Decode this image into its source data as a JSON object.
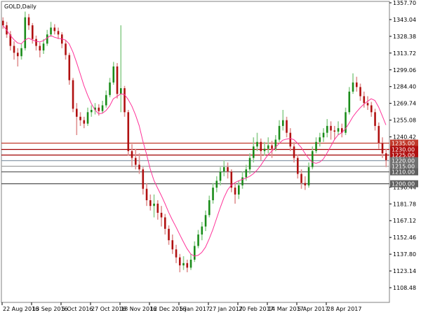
{
  "chart_data": {
    "type": "candlestick",
    "title": "GOLD,Daily",
    "ylim": [
      1108.48,
      1357.7
    ],
    "y_ticks": [
      "1357.70",
      "1343.04",
      "1328.38",
      "1313.72",
      "1299.06",
      "1284.40",
      "1269.74",
      "1255.08",
      "1240.42",
      "1196.44",
      "1181.78",
      "1167.12",
      "1152.46",
      "1137.80",
      "1123.14",
      "1108.48"
    ],
    "x_ticks": [
      "22 Aug 2016",
      "13 Sep 2016",
      "5 Oct 2016",
      "27 Oct 2016",
      "18 Nov 2016",
      "12 Dec 2016",
      "5 Jan 2017",
      "27 Jan 2017",
      "20 Feb 2017",
      "14 Mar 2017",
      "5 Apr 2017",
      "28 Apr 2017"
    ],
    "ohlc": [
      [
        1342,
        1345,
        1335,
        1338
      ],
      [
        1338,
        1341,
        1327,
        1330
      ],
      [
        1330,
        1333,
        1316,
        1320
      ],
      [
        1320,
        1324,
        1308,
        1314
      ],
      [
        1314,
        1318,
        1302,
        1311
      ],
      [
        1311,
        1322,
        1308,
        1318
      ],
      [
        1318,
        1350,
        1316,
        1345
      ],
      [
        1345,
        1348,
        1334,
        1338
      ],
      [
        1338,
        1340,
        1322,
        1326
      ],
      [
        1326,
        1329,
        1316,
        1320
      ],
      [
        1320,
        1323,
        1310,
        1316
      ],
      [
        1316,
        1326,
        1313,
        1322
      ],
      [
        1322,
        1334,
        1320,
        1330
      ],
      [
        1330,
        1341,
        1328,
        1336
      ],
      [
        1336,
        1339,
        1330,
        1333
      ],
      [
        1333,
        1336,
        1326,
        1330
      ],
      [
        1330,
        1332,
        1318,
        1322
      ],
      [
        1322,
        1325,
        1308,
        1312
      ],
      [
        1312,
        1314,
        1286,
        1290
      ],
      [
        1290,
        1292,
        1262,
        1265
      ],
      [
        1265,
        1270,
        1242,
        1258
      ],
      [
        1258,
        1262,
        1250,
        1255
      ],
      [
        1255,
        1258,
        1248,
        1252
      ],
      [
        1252,
        1266,
        1250,
        1262
      ],
      [
        1262,
        1268,
        1258,
        1264
      ],
      [
        1264,
        1270,
        1260,
        1266
      ],
      [
        1266,
        1269,
        1259,
        1263
      ],
      [
        1263,
        1272,
        1261,
        1268
      ],
      [
        1268,
        1281,
        1266,
        1277
      ],
      [
        1277,
        1292,
        1275,
        1288
      ],
      [
        1288,
        1306,
        1286,
        1302
      ],
      [
        1302,
        1305,
        1274,
        1278
      ],
      [
        1278,
        1338,
        1262,
        1283
      ],
      [
        1283,
        1285,
        1258,
        1262
      ],
      [
        1262,
        1264,
        1224,
        1228
      ],
      [
        1228,
        1234,
        1214,
        1222
      ],
      [
        1222,
        1230,
        1212,
        1216
      ],
      [
        1216,
        1226,
        1208,
        1212
      ],
      [
        1212,
        1214,
        1190,
        1195
      ],
      [
        1195,
        1200,
        1180,
        1185
      ],
      [
        1185,
        1190,
        1176,
        1180
      ],
      [
        1180,
        1190,
        1170,
        1182
      ],
      [
        1182,
        1185,
        1168,
        1174
      ],
      [
        1174,
        1180,
        1162,
        1170
      ],
      [
        1170,
        1173,
        1155,
        1160
      ],
      [
        1160,
        1163,
        1146,
        1150
      ],
      [
        1150,
        1155,
        1138,
        1142
      ],
      [
        1142,
        1146,
        1130,
        1135
      ],
      [
        1135,
        1138,
        1122,
        1128
      ],
      [
        1128,
        1136,
        1124,
        1130
      ],
      [
        1130,
        1133,
        1122,
        1126
      ],
      [
        1126,
        1138,
        1124,
        1133
      ],
      [
        1133,
        1149,
        1131,
        1145
      ],
      [
        1145,
        1159,
        1143,
        1155
      ],
      [
        1155,
        1166,
        1150,
        1162
      ],
      [
        1162,
        1176,
        1158,
        1172
      ],
      [
        1172,
        1189,
        1170,
        1185
      ],
      [
        1185,
        1200,
        1182,
        1196
      ],
      [
        1196,
        1206,
        1192,
        1202
      ],
      [
        1202,
        1214,
        1198,
        1210
      ],
      [
        1210,
        1220,
        1206,
        1214
      ],
      [
        1214,
        1218,
        1204,
        1210
      ],
      [
        1210,
        1212,
        1192,
        1196
      ],
      [
        1196,
        1200,
        1182,
        1190
      ],
      [
        1190,
        1202,
        1186,
        1198
      ],
      [
        1198,
        1210,
        1195,
        1205
      ],
      [
        1205,
        1216,
        1202,
        1212
      ],
      [
        1212,
        1226,
        1208,
        1222
      ],
      [
        1222,
        1240,
        1218,
        1232
      ],
      [
        1232,
        1244,
        1228,
        1236
      ],
      [
        1236,
        1239,
        1220,
        1228
      ],
      [
        1228,
        1236,
        1224,
        1230
      ],
      [
        1230,
        1240,
        1226,
        1233
      ],
      [
        1233,
        1237,
        1222,
        1230
      ],
      [
        1230,
        1242,
        1228,
        1238
      ],
      [
        1238,
        1255,
        1236,
        1250
      ],
      [
        1250,
        1264,
        1246,
        1255
      ],
      [
        1255,
        1258,
        1240,
        1244
      ],
      [
        1244,
        1248,
        1228,
        1232
      ],
      [
        1232,
        1236,
        1218,
        1222
      ],
      [
        1222,
        1225,
        1204,
        1208
      ],
      [
        1208,
        1212,
        1195,
        1200
      ],
      [
        1200,
        1206,
        1194,
        1198
      ],
      [
        1198,
        1218,
        1196,
        1214
      ],
      [
        1214,
        1232,
        1212,
        1228
      ],
      [
        1228,
        1240,
        1226,
        1236
      ],
      [
        1236,
        1244,
        1232,
        1240
      ],
      [
        1240,
        1248,
        1236,
        1244
      ],
      [
        1244,
        1256,
        1240,
        1250
      ],
      [
        1250,
        1254,
        1238,
        1246
      ],
      [
        1246,
        1250,
        1238,
        1245
      ],
      [
        1245,
        1254,
        1242,
        1248
      ],
      [
        1248,
        1252,
        1240,
        1244
      ],
      [
        1244,
        1266,
        1242,
        1262
      ],
      [
        1262,
        1284,
        1260,
        1280
      ],
      [
        1280,
        1296,
        1278,
        1288
      ],
      [
        1288,
        1293,
        1280,
        1284
      ],
      [
        1284,
        1287,
        1272,
        1276
      ],
      [
        1276,
        1280,
        1266,
        1270
      ],
      [
        1270,
        1276,
        1264,
        1268
      ],
      [
        1268,
        1271,
        1258,
        1262
      ],
      [
        1262,
        1265,
        1246,
        1250
      ],
      [
        1250,
        1253,
        1230,
        1235
      ],
      [
        1235,
        1240,
        1222,
        1226
      ],
      [
        1226,
        1230,
        1214,
        1220
      ]
    ],
    "moving_average": {
      "period": 8,
      "color": "#ff3399"
    },
    "levels": [
      {
        "price": 1235,
        "label": "1235.00",
        "color": "#c0392b",
        "box": "#c0392b"
      },
      {
        "price": 1230,
        "label": "1230.00",
        "color": "#a00000",
        "box": "#b01010"
      },
      {
        "price": 1225,
        "label": "1225.00",
        "color": "#a00000",
        "box": "#b01010"
      },
      {
        "price": 1220,
        "label": "1220.00",
        "color": "#8a9aa8",
        "box": "#707070"
      },
      {
        "price": 1215,
        "label": "1215.00",
        "color": "#a0a0a0",
        "box": "#707070"
      },
      {
        "price": 1210,
        "label": "1210.00",
        "color": "#606060",
        "box": "#606060"
      },
      {
        "price": 1200,
        "label": "1200.00",
        "color": "#505050",
        "box": "#606060"
      }
    ],
    "colors": {
      "bull_body": "#1a8c1a",
      "bull_wick": "#8fcf8f",
      "bear_body": "#b01010",
      "bear_wick": "#e09090"
    },
    "grid": false
  }
}
